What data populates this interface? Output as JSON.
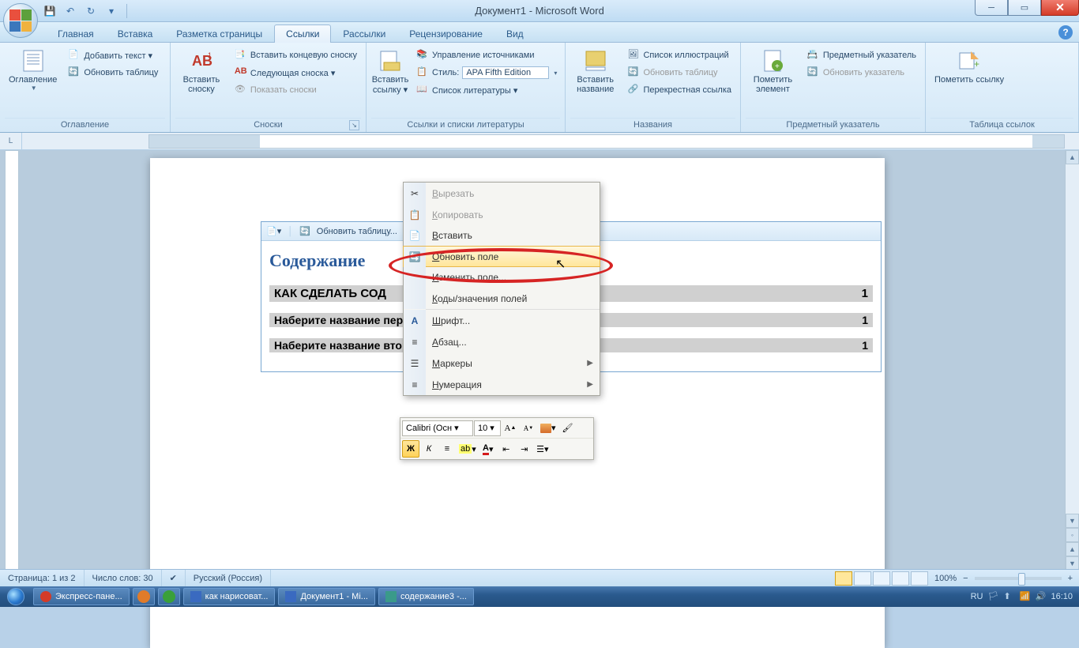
{
  "title": "Документ1 - Microsoft Word",
  "qat": {
    "save": "💾",
    "undo": "↶",
    "redo": "↻"
  },
  "tabs": [
    "Главная",
    "Вставка",
    "Разметка страницы",
    "Ссылки",
    "Рассылки",
    "Рецензирование",
    "Вид"
  ],
  "active_tab": 3,
  "ribbon": {
    "g1": {
      "label": "Оглавление",
      "big": "Оглавление",
      "items": [
        "Добавить текст ▾",
        "Обновить таблицу"
      ]
    },
    "g2": {
      "label": "Сноски",
      "big": "Вставить сноску",
      "items": [
        "Вставить концевую сноску",
        "Следующая сноска ▾",
        "Показать сноски"
      ]
    },
    "g3": {
      "label": "Ссылки и списки литературы",
      "big": "Вставить ссылку ▾",
      "items": [
        "Управление источниками",
        "Стиль:",
        "Список литературы ▾"
      ],
      "style": "APA Fifth Edition"
    },
    "g4": {
      "label": "Названия",
      "big": "Вставить название",
      "items": [
        "Список иллюстраций",
        "Обновить таблицу",
        "Перекрестная ссылка"
      ]
    },
    "g5": {
      "label": "Предметный указатель",
      "big": "Пометить элемент",
      "items": [
        "Предметный указатель",
        "Обновить указатель"
      ]
    },
    "g6": {
      "label": "Таблица ссылок",
      "big": "Пометить ссылку"
    }
  },
  "toc": {
    "header_btn": "Обновить таблицу...",
    "title": "Содержание",
    "rows": [
      {
        "t": "КАК СДЕЛАТЬ СОД",
        "p": "1"
      },
      {
        "t": "Наберите название перв",
        "p": "1"
      },
      {
        "t": "Наберите название второго раздела",
        "p": "1"
      }
    ]
  },
  "ctx": {
    "items": [
      {
        "icon": "cut",
        "label": "Вырезать",
        "u": "В",
        "disabled": true
      },
      {
        "icon": "copy",
        "label": "Копировать",
        "u": "К",
        "disabled": true
      },
      {
        "icon": "paste",
        "label": "Вставить",
        "u": "В"
      },
      {
        "icon": "refresh",
        "label": "Обновить поле",
        "u": "О",
        "highlight": true
      },
      {
        "icon": "",
        "label": "Изменить поле...",
        "u": "И"
      },
      {
        "icon": "",
        "label": "Коды/значения полей",
        "u": "К"
      },
      {
        "sep": true
      },
      {
        "icon": "font",
        "label": "Шрифт...",
        "u": "Ш"
      },
      {
        "icon": "para",
        "label": "Абзац...",
        "u": "А"
      },
      {
        "icon": "bullets",
        "label": "Маркеры",
        "u": "М",
        "sub": true
      },
      {
        "icon": "numbers",
        "label": "Нумерация",
        "u": "Н",
        "sub": true
      }
    ]
  },
  "minitb": {
    "font": "Calibri (Осн",
    "size": "10"
  },
  "status": {
    "page": "Страница: 1 из 2",
    "words": "Число слов: 30",
    "lang": "Русский (Россия)",
    "zoom": "100%"
  },
  "taskbar": {
    "items": [
      {
        "t": "Экспресс-пане...",
        "c": "#d43b28"
      },
      {
        "t": "",
        "c": "#e07b2a",
        "icon": true
      },
      {
        "t": "",
        "c": "#3aa03a",
        "icon": true
      },
      {
        "t": "как нарисоват...",
        "c": "#3a6ac0"
      },
      {
        "t": "Документ1 - Mi...",
        "c": "#3a6ac0"
      },
      {
        "t": "содержание3 -...",
        "c": "#3a9a8a"
      }
    ],
    "lang": "RU",
    "time": "16:10"
  }
}
